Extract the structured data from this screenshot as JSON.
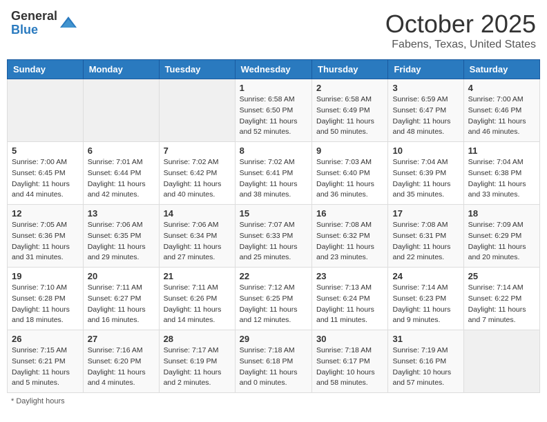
{
  "header": {
    "logo_general": "General",
    "logo_blue": "Blue",
    "month": "October 2025",
    "location": "Fabens, Texas, United States"
  },
  "days_of_week": [
    "Sunday",
    "Monday",
    "Tuesday",
    "Wednesday",
    "Thursday",
    "Friday",
    "Saturday"
  ],
  "weeks": [
    [
      {
        "day": "",
        "sunrise": "",
        "sunset": "",
        "daylight": ""
      },
      {
        "day": "",
        "sunrise": "",
        "sunset": "",
        "daylight": ""
      },
      {
        "day": "",
        "sunrise": "",
        "sunset": "",
        "daylight": ""
      },
      {
        "day": "1",
        "sunrise": "Sunrise: 6:58 AM",
        "sunset": "Sunset: 6:50 PM",
        "daylight": "Daylight: 11 hours and 52 minutes."
      },
      {
        "day": "2",
        "sunrise": "Sunrise: 6:58 AM",
        "sunset": "Sunset: 6:49 PM",
        "daylight": "Daylight: 11 hours and 50 minutes."
      },
      {
        "day": "3",
        "sunrise": "Sunrise: 6:59 AM",
        "sunset": "Sunset: 6:47 PM",
        "daylight": "Daylight: 11 hours and 48 minutes."
      },
      {
        "day": "4",
        "sunrise": "Sunrise: 7:00 AM",
        "sunset": "Sunset: 6:46 PM",
        "daylight": "Daylight: 11 hours and 46 minutes."
      }
    ],
    [
      {
        "day": "5",
        "sunrise": "Sunrise: 7:00 AM",
        "sunset": "Sunset: 6:45 PM",
        "daylight": "Daylight: 11 hours and 44 minutes."
      },
      {
        "day": "6",
        "sunrise": "Sunrise: 7:01 AM",
        "sunset": "Sunset: 6:44 PM",
        "daylight": "Daylight: 11 hours and 42 minutes."
      },
      {
        "day": "7",
        "sunrise": "Sunrise: 7:02 AM",
        "sunset": "Sunset: 6:42 PM",
        "daylight": "Daylight: 11 hours and 40 minutes."
      },
      {
        "day": "8",
        "sunrise": "Sunrise: 7:02 AM",
        "sunset": "Sunset: 6:41 PM",
        "daylight": "Daylight: 11 hours and 38 minutes."
      },
      {
        "day": "9",
        "sunrise": "Sunrise: 7:03 AM",
        "sunset": "Sunset: 6:40 PM",
        "daylight": "Daylight: 11 hours and 36 minutes."
      },
      {
        "day": "10",
        "sunrise": "Sunrise: 7:04 AM",
        "sunset": "Sunset: 6:39 PM",
        "daylight": "Daylight: 11 hours and 35 minutes."
      },
      {
        "day": "11",
        "sunrise": "Sunrise: 7:04 AM",
        "sunset": "Sunset: 6:38 PM",
        "daylight": "Daylight: 11 hours and 33 minutes."
      }
    ],
    [
      {
        "day": "12",
        "sunrise": "Sunrise: 7:05 AM",
        "sunset": "Sunset: 6:36 PM",
        "daylight": "Daylight: 11 hours and 31 minutes."
      },
      {
        "day": "13",
        "sunrise": "Sunrise: 7:06 AM",
        "sunset": "Sunset: 6:35 PM",
        "daylight": "Daylight: 11 hours and 29 minutes."
      },
      {
        "day": "14",
        "sunrise": "Sunrise: 7:06 AM",
        "sunset": "Sunset: 6:34 PM",
        "daylight": "Daylight: 11 hours and 27 minutes."
      },
      {
        "day": "15",
        "sunrise": "Sunrise: 7:07 AM",
        "sunset": "Sunset: 6:33 PM",
        "daylight": "Daylight: 11 hours and 25 minutes."
      },
      {
        "day": "16",
        "sunrise": "Sunrise: 7:08 AM",
        "sunset": "Sunset: 6:32 PM",
        "daylight": "Daylight: 11 hours and 23 minutes."
      },
      {
        "day": "17",
        "sunrise": "Sunrise: 7:08 AM",
        "sunset": "Sunset: 6:31 PM",
        "daylight": "Daylight: 11 hours and 22 minutes."
      },
      {
        "day": "18",
        "sunrise": "Sunrise: 7:09 AM",
        "sunset": "Sunset: 6:29 PM",
        "daylight": "Daylight: 11 hours and 20 minutes."
      }
    ],
    [
      {
        "day": "19",
        "sunrise": "Sunrise: 7:10 AM",
        "sunset": "Sunset: 6:28 PM",
        "daylight": "Daylight: 11 hours and 18 minutes."
      },
      {
        "day": "20",
        "sunrise": "Sunrise: 7:11 AM",
        "sunset": "Sunset: 6:27 PM",
        "daylight": "Daylight: 11 hours and 16 minutes."
      },
      {
        "day": "21",
        "sunrise": "Sunrise: 7:11 AM",
        "sunset": "Sunset: 6:26 PM",
        "daylight": "Daylight: 11 hours and 14 minutes."
      },
      {
        "day": "22",
        "sunrise": "Sunrise: 7:12 AM",
        "sunset": "Sunset: 6:25 PM",
        "daylight": "Daylight: 11 hours and 12 minutes."
      },
      {
        "day": "23",
        "sunrise": "Sunrise: 7:13 AM",
        "sunset": "Sunset: 6:24 PM",
        "daylight": "Daylight: 11 hours and 11 minutes."
      },
      {
        "day": "24",
        "sunrise": "Sunrise: 7:14 AM",
        "sunset": "Sunset: 6:23 PM",
        "daylight": "Daylight: 11 hours and 9 minutes."
      },
      {
        "day": "25",
        "sunrise": "Sunrise: 7:14 AM",
        "sunset": "Sunset: 6:22 PM",
        "daylight": "Daylight: 11 hours and 7 minutes."
      }
    ],
    [
      {
        "day": "26",
        "sunrise": "Sunrise: 7:15 AM",
        "sunset": "Sunset: 6:21 PM",
        "daylight": "Daylight: 11 hours and 5 minutes."
      },
      {
        "day": "27",
        "sunrise": "Sunrise: 7:16 AM",
        "sunset": "Sunset: 6:20 PM",
        "daylight": "Daylight: 11 hours and 4 minutes."
      },
      {
        "day": "28",
        "sunrise": "Sunrise: 7:17 AM",
        "sunset": "Sunset: 6:19 PM",
        "daylight": "Daylight: 11 hours and 2 minutes."
      },
      {
        "day": "29",
        "sunrise": "Sunrise: 7:18 AM",
        "sunset": "Sunset: 6:18 PM",
        "daylight": "Daylight: 11 hours and 0 minutes."
      },
      {
        "day": "30",
        "sunrise": "Sunrise: 7:18 AM",
        "sunset": "Sunset: 6:17 PM",
        "daylight": "Daylight: 10 hours and 58 minutes."
      },
      {
        "day": "31",
        "sunrise": "Sunrise: 7:19 AM",
        "sunset": "Sunset: 6:16 PM",
        "daylight": "Daylight: 10 hours and 57 minutes."
      },
      {
        "day": "",
        "sunrise": "",
        "sunset": "",
        "daylight": ""
      }
    ]
  ],
  "footer": {
    "daylight_label": "Daylight hours"
  }
}
